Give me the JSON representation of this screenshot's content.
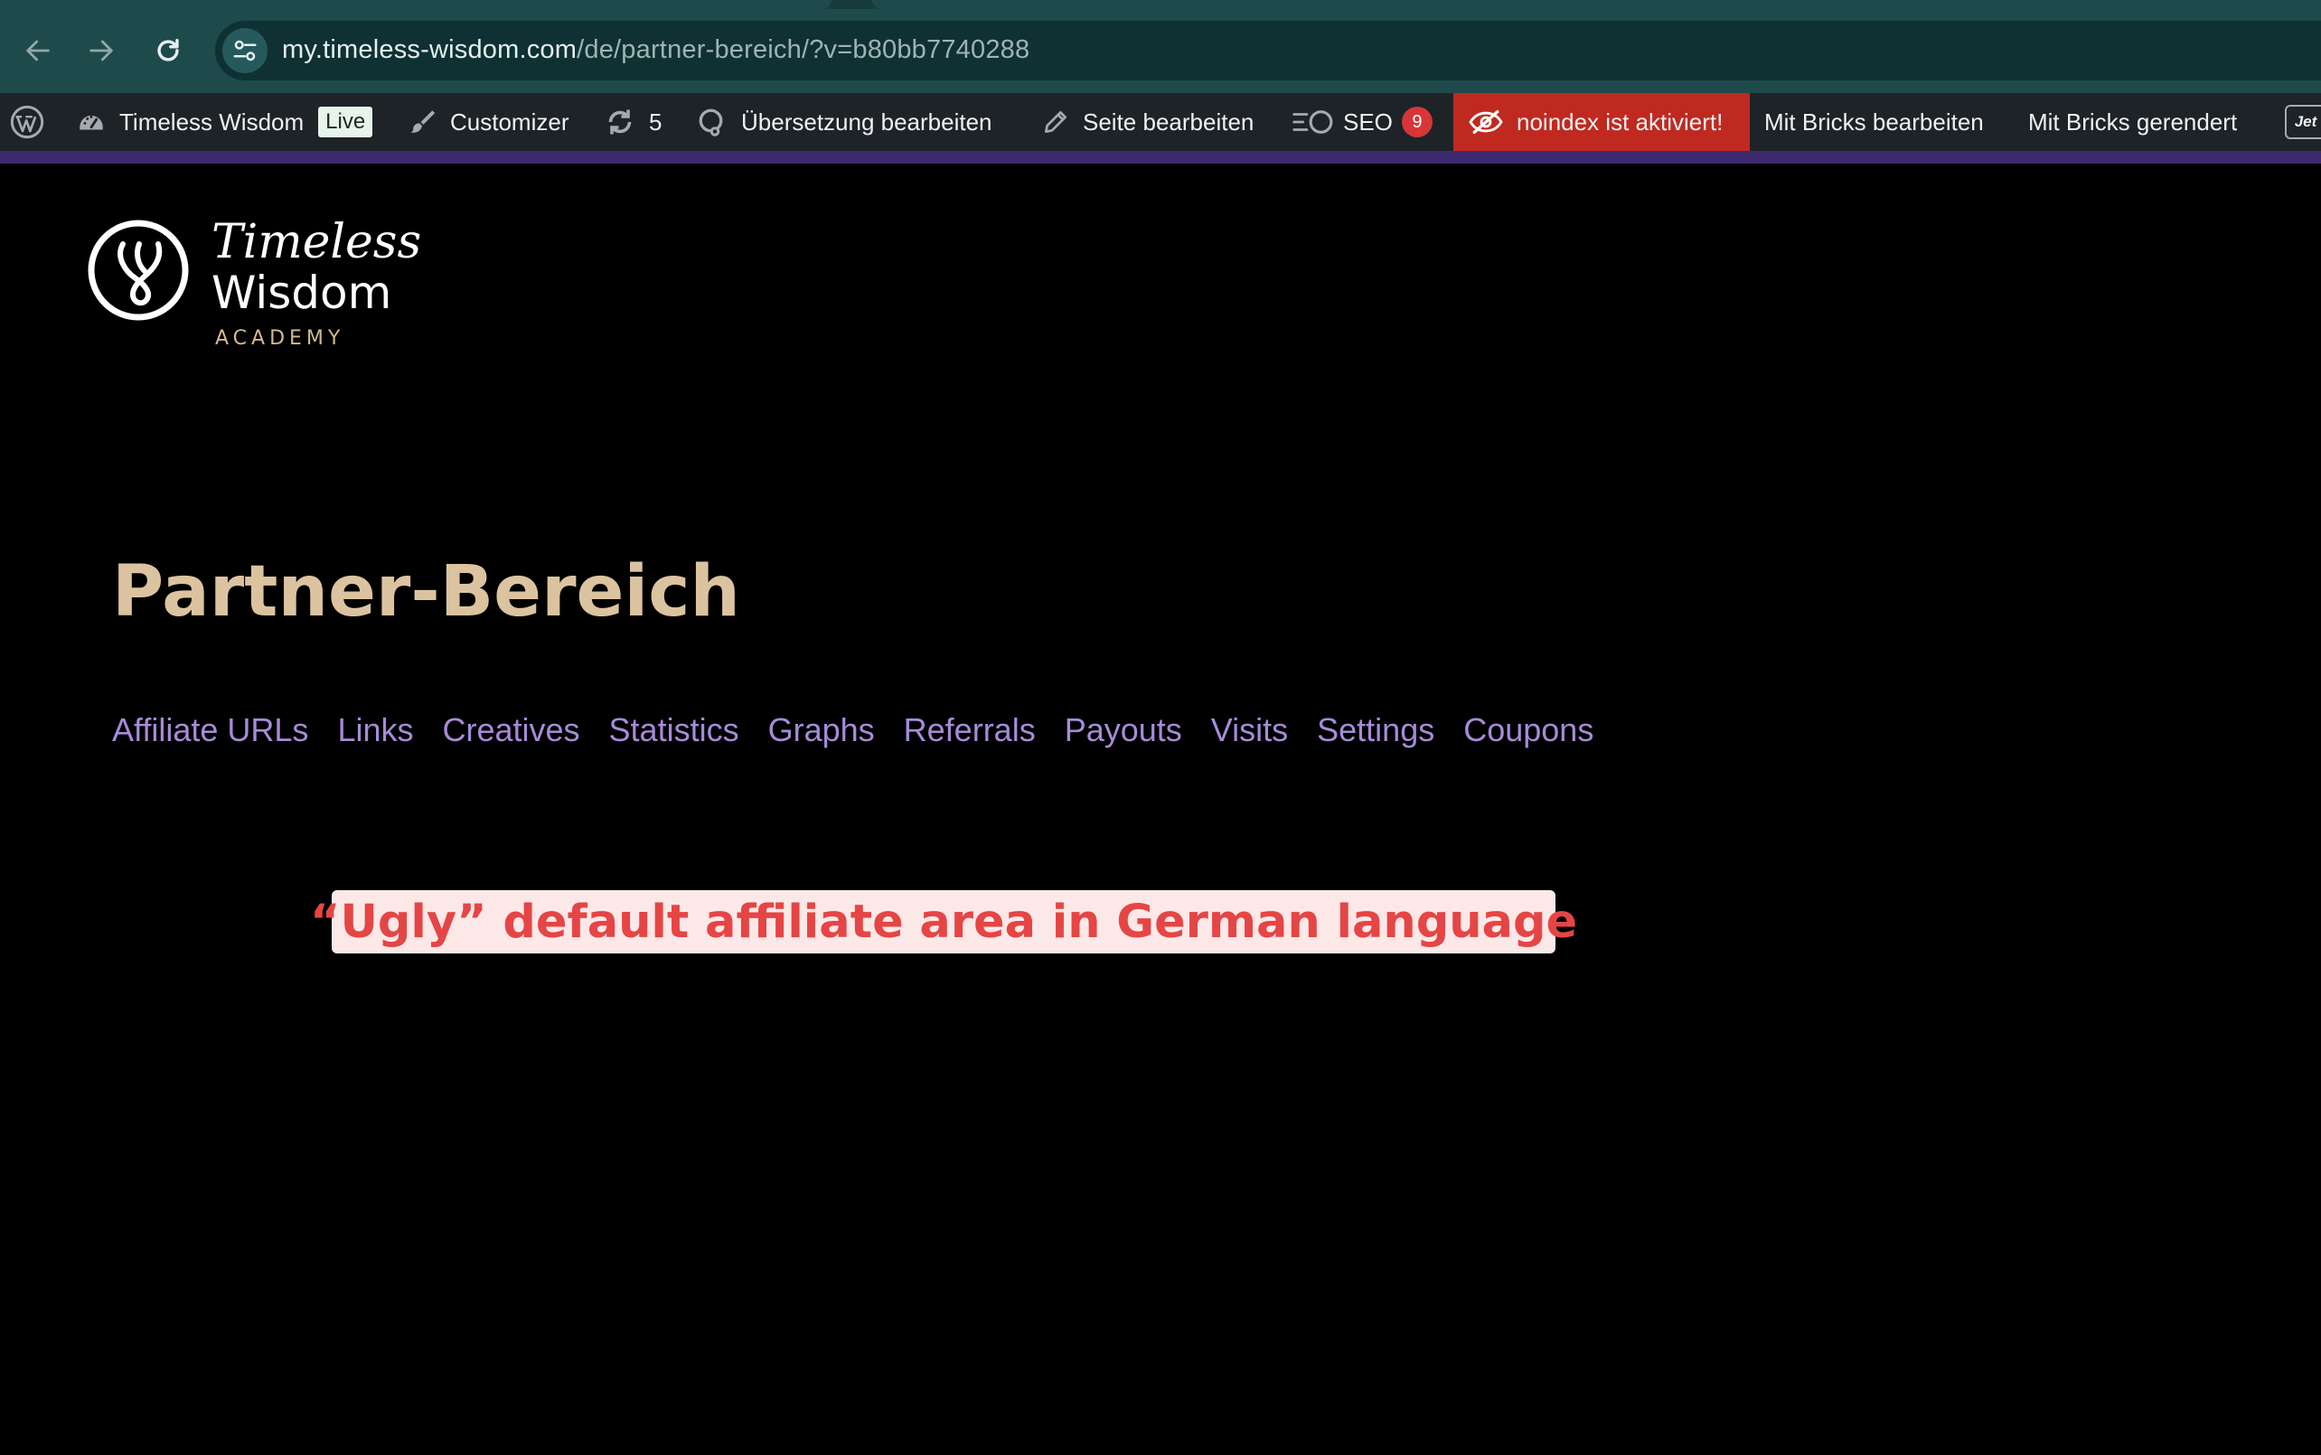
{
  "browser": {
    "url_domain": "my.timeless-wisdom.com",
    "url_path": "/de/partner-bereich/?v=b80bb7740288"
  },
  "admin_bar": {
    "site_name": "Timeless Wisdom",
    "live_label": "Live",
    "customizer": "Customizer",
    "updates_count": "5",
    "translate": "Übersetzung bearbeiten",
    "edit_page": "Seite bearbeiten",
    "seo": "SEO",
    "seo_count": "9",
    "noindex": "noindex ist aktiviert!",
    "bricks_edit": "Mit Bricks bearbeiten",
    "bricks_rendered": "Mit Bricks gerendert",
    "jet_label": "Jet"
  },
  "logo": {
    "line1": "Timeless",
    "line2": "Wisdom",
    "line3": "ACADEMY"
  },
  "page": {
    "title": "Partner-Bereich",
    "tabs": [
      "Affiliate URLs",
      "Links",
      "Creatives",
      "Statistics",
      "Graphs",
      "Referrals",
      "Payouts",
      "Visits",
      "Settings",
      "Coupons"
    ]
  },
  "annotation": "“Ugly” default affiliate area in German language",
  "colors": {
    "browser_bar": "#1f4a4c",
    "admin_bar": "#1d2327",
    "title": "#dcc3a0",
    "tab_link": "#a78bd8",
    "noindex_bg": "#c0291f",
    "annotation_text": "#e54545",
    "annotation_bg": "#fde8e8"
  }
}
